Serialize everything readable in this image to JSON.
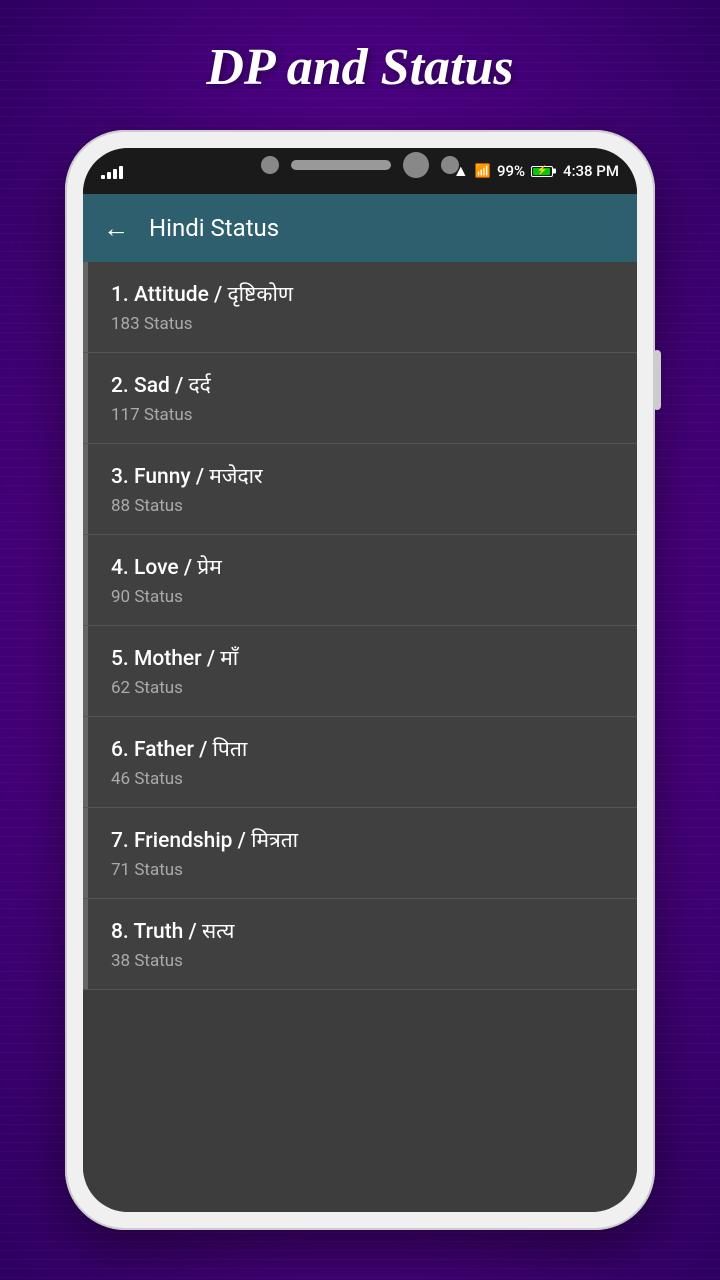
{
  "app_title": "DP and Status",
  "phone": {
    "status_bar": {
      "time": "4:38 PM",
      "battery_percent": "99%",
      "wifi": "wifi",
      "signal": "signal"
    },
    "app_bar": {
      "back_label": "←",
      "title": "Hindi Status"
    },
    "list_items": [
      {
        "id": 1,
        "title": "1. Attitude / दृष्टिकोण",
        "subtitle": "183 Status"
      },
      {
        "id": 2,
        "title": "2. Sad / दर्द",
        "subtitle": "117 Status"
      },
      {
        "id": 3,
        "title": "3. Funny / मजेदार",
        "subtitle": "88 Status"
      },
      {
        "id": 4,
        "title": "4. Love / प्रेम",
        "subtitle": "90 Status"
      },
      {
        "id": 5,
        "title": "5. Mother / माँ",
        "subtitle": "62 Status"
      },
      {
        "id": 6,
        "title": "6. Father / पिता",
        "subtitle": "46 Status"
      },
      {
        "id": 7,
        "title": "7. Friendship /  मित्रता",
        "subtitle": "71 Status"
      },
      {
        "id": 8,
        "title": "8. Truth / सत्य",
        "subtitle": "38 Status"
      }
    ]
  }
}
